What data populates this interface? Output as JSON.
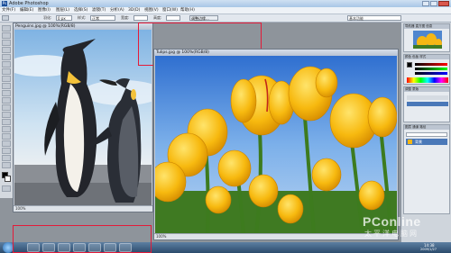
{
  "app": {
    "title": "Adobe Photoshop"
  },
  "menu": [
    "文件(F)",
    "编辑(E)",
    "图像(I)",
    "图层(L)",
    "选择(S)",
    "滤镜(T)",
    "分析(A)",
    "3D(D)",
    "视图(V)",
    "窗口(W)",
    "帮助(H)"
  ],
  "options": {
    "feather_label": "羽化:",
    "feather_value": "0 px",
    "style_label": "样式:",
    "style_value": "正常",
    "width_label": "宽度:",
    "height_label": "高度:",
    "refine_label": "调整边缘...",
    "workspace": "基本功能"
  },
  "documents": {
    "penguins": {
      "title": "Penguins.jpg @ 100%(RGB/8)",
      "status": "100%"
    },
    "tulips": {
      "title": "Tulips.jpg @ 100%(RGB/8)",
      "status": "100%"
    }
  },
  "panels": {
    "nav_tabs": "导航器  直方图  信息",
    "color_tabs": "颜色  色板  样式",
    "adjust_tabs": "调整  蒙版",
    "layers_tabs": "图层  通道  路径",
    "layer_name": "背景"
  },
  "taskbar": {
    "time": "14:38",
    "date": "2009/1/27"
  },
  "watermark": {
    "brand": "PConline",
    "sub": "太平洋电脑网"
  }
}
